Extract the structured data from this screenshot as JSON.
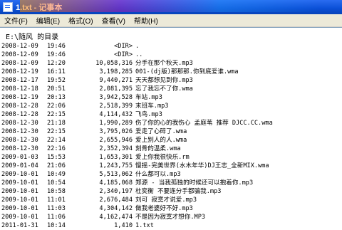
{
  "window": {
    "title": "1.txt - 记事本"
  },
  "menu": [
    "文件(F)",
    "编辑(E)",
    "格式(O)",
    "查看(V)",
    "帮助(H)"
  ],
  "directory_header": "E:\\随风 的目录",
  "listing": [
    {
      "date": "2008-12-09",
      "time": "19:46",
      "size": "<DIR>",
      "name": "."
    },
    {
      "date": "2008-12-09",
      "time": "19:46",
      "size": "<DIR>",
      "name": ".."
    },
    {
      "date": "2008-12-09",
      "time": "12:20",
      "size": "10,058,316",
      "name": "分手在那个秋天.mp3"
    },
    {
      "date": "2008-12-19",
      "time": "16:11",
      "size": "3,198,285",
      "name": "001-(dj版)那那那.你到底爱谁.wma"
    },
    {
      "date": "2008-12-17",
      "time": "19:52",
      "size": "9,440,271",
      "name": "天天都想见到你.mp3"
    },
    {
      "date": "2008-12-18",
      "time": "20:51",
      "size": "2,081,395",
      "name": "忘了我忘不了你.wma"
    },
    {
      "date": "2008-12-19",
      "time": "20:13",
      "size": "3,942,528",
      "name": "车站.mp3"
    },
    {
      "date": "2008-12-28",
      "time": "22:06",
      "size": "2,518,399",
      "name": "末班车.mp3"
    },
    {
      "date": "2008-12-28",
      "time": "22:15",
      "size": "4,114,432",
      "name": "飞鸟.mp3"
    },
    {
      "date": "2008-12-30",
      "time": "21:18",
      "size": "1,990,289",
      "name": "伤了你的心的我伤心 孟庭苇 推荐 DJCC.CC.wma"
    },
    {
      "date": "2008-12-30",
      "time": "22:15",
      "size": "3,795,026",
      "name": "爱走了心碎了.wma"
    },
    {
      "date": "2008-12-30",
      "time": "22:14",
      "size": "2,655,946",
      "name": "爱上别人的人.wma"
    },
    {
      "date": "2008-12-30",
      "time": "22:16",
      "size": "2,352,394",
      "name": "刻骨的温柔.wma"
    },
    {
      "date": "2009-01-03",
      "time": "15:53",
      "size": "1,653,301",
      "name": "爱上你我很快乐.rm"
    },
    {
      "date": "2009-01-04",
      "time": "21:06",
      "size": "1,243,755",
      "name": "慢摇-完美世界(水木年华)DJ王志_全新MIX.wma"
    },
    {
      "date": "2009-10-01",
      "time": "10:49",
      "size": "5,513,062",
      "name": "什么都可以.mp3"
    },
    {
      "date": "2009-10-01",
      "time": "10:54",
      "size": "4,185,068",
      "name": "郑源 - 当我孤独的时候还可以抱着你.mp3"
    },
    {
      "date": "2009-10-01",
      "time": "10:58",
      "size": "2,340,197",
      "name": "杜奕衡 不要连分手都骗我.mp3"
    },
    {
      "date": "2009-10-01",
      "time": "11:01",
      "size": "2,676,484",
      "name": "刘可 寂寞才说爱.mp3"
    },
    {
      "date": "2009-10-01",
      "time": "11:03",
      "size": "4,304,142",
      "name": "做我老婆好不好.mp3"
    },
    {
      "date": "2009-10-01",
      "time": "11:06",
      "size": "4,162,474",
      "name": "不是因为寂寞才想你.MP3"
    },
    {
      "date": "2011-01-31",
      "time": "10:14",
      "size": "1,410",
      "name": "1.txt"
    }
  ]
}
